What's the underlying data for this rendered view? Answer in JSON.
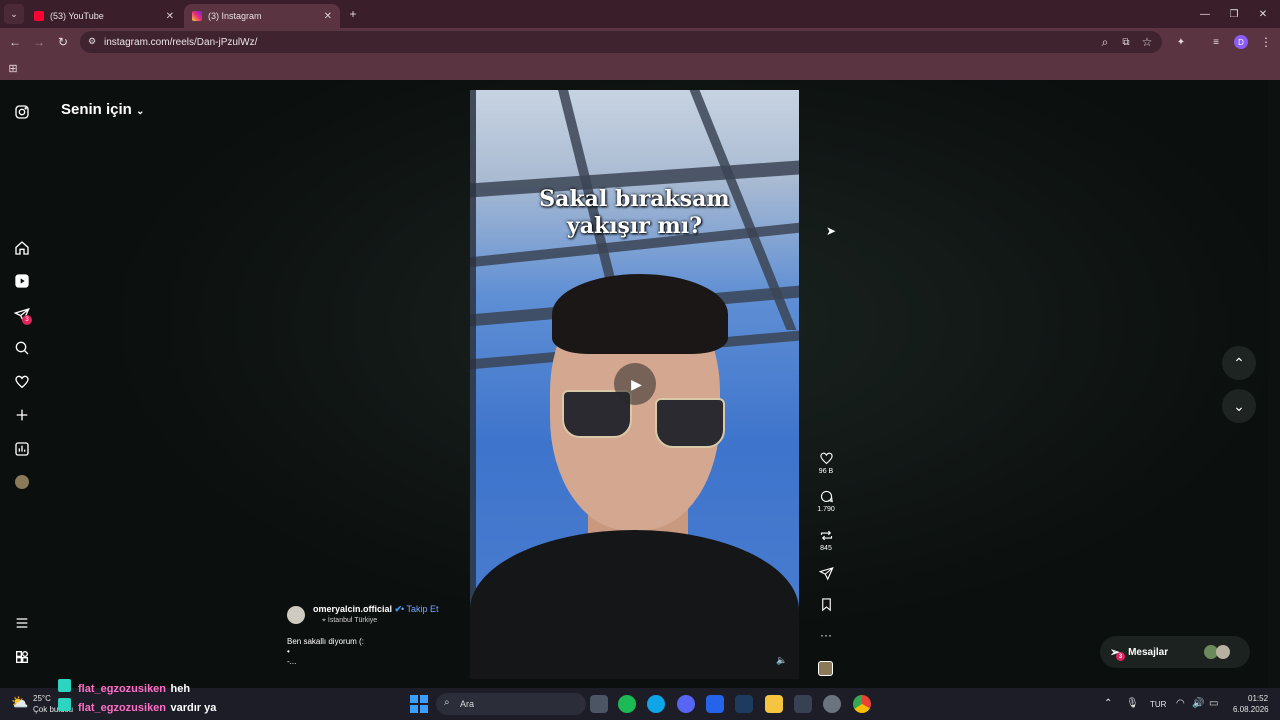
{
  "browser": {
    "tabs": [
      {
        "label": "(53) YouTube",
        "icon": "youtube-icon",
        "color": "#ff0033"
      },
      {
        "label": "(3) Instagram",
        "icon": "instagram-icon",
        "color": "#e1306c"
      }
    ],
    "url": "instagram.com/reels/Dan-jPzulWz/"
  },
  "sidebar": {
    "feed_label": "Senin için",
    "notifications_badge": "3"
  },
  "reel": {
    "caption_line1": "Sakal bıraksam",
    "caption_line2": "yakışır mı?",
    "username": "omeryalcin.official",
    "follow_label": "• Takip Et",
    "location": "İstanbul Türkiye",
    "description_line1": "Ben sakallı diyorum (:",
    "description_line2": "•",
    "description_line3": "-...",
    "likes": "96 B",
    "comments": "1.790",
    "reposts": "845"
  },
  "messages": {
    "label": "Mesajlar",
    "badge": "3"
  },
  "stream_chat": [
    {
      "user": "flat_egzozusiken",
      "message": "heh"
    },
    {
      "user": "flat_egzozusiken",
      "message": "vardır ya"
    }
  ],
  "taskbar": {
    "weather_temp": "25°C",
    "weather_desc": "Çok bulutlu",
    "search_placeholder": "Ara",
    "lang": "TUR",
    "time": "01:52",
    "date": "6.08.2026"
  },
  "colors": {
    "accent_follow": "#7aa2ff",
    "chat_user": "#ff6ec7",
    "badge": "#e0245e"
  }
}
